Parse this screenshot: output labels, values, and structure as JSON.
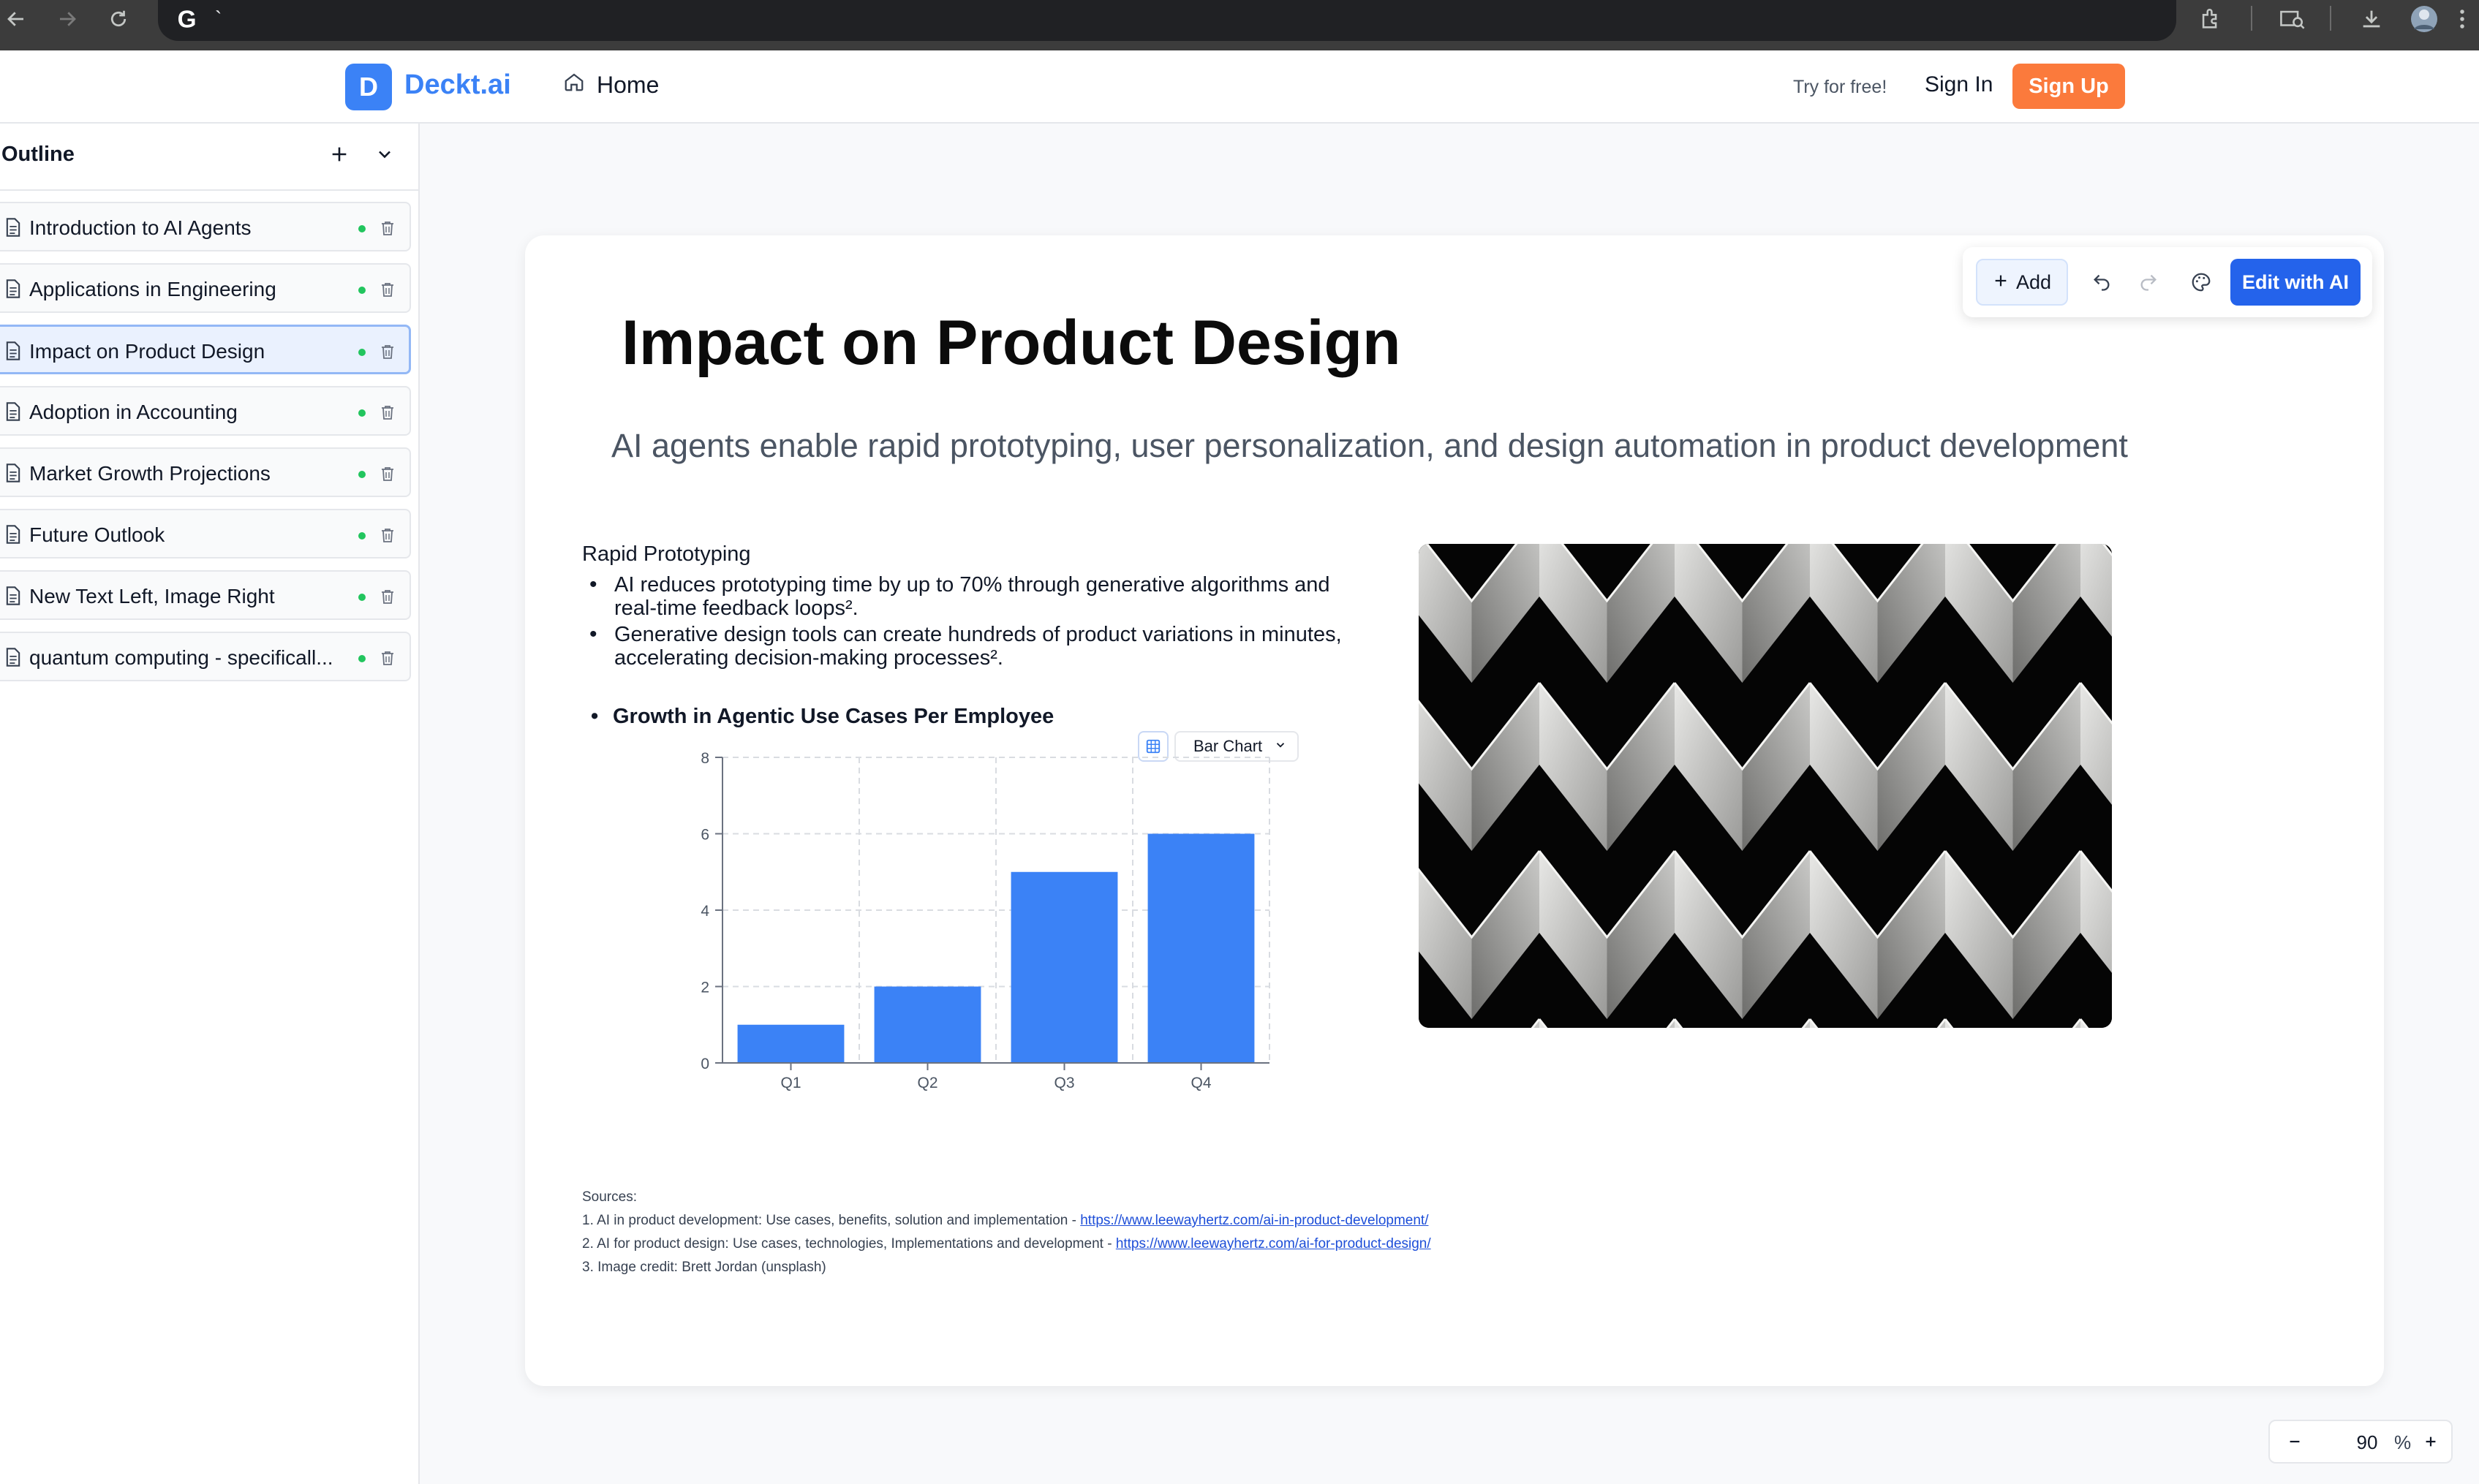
{
  "browser": {
    "address_text": "`"
  },
  "header": {
    "logo_letter": "D",
    "brand": "Deckt.ai",
    "home_label": "Home",
    "try_free": "Try for free!",
    "sign_in": "Sign In",
    "sign_up": "Sign Up"
  },
  "sidebar": {
    "title": "Outline",
    "items": [
      {
        "label": "Introduction to AI Agents"
      },
      {
        "label": "Applications in Engineering"
      },
      {
        "label": "Impact on Product Design",
        "active": true
      },
      {
        "label": "Adoption in Accounting"
      },
      {
        "label": "Market Growth Projections"
      },
      {
        "label": "Future Outlook"
      },
      {
        "label": "New Text Left, Image Right"
      },
      {
        "label": "quantum computing - specificall..."
      }
    ]
  },
  "toolbar": {
    "add_label": "Add",
    "edit_label": "Edit with AI"
  },
  "slide": {
    "title": "Impact on Product Design",
    "subtitle": "AI agents enable rapid prototyping, user personalization, and design automation in product development",
    "section_heading": "Rapid Prototyping",
    "bullets": [
      "AI reduces prototyping time by up to 70% through generative algorithms and real-time feedback loops².",
      "Generative design tools can create hundreds of product variations in minutes, accelerating decision-making processes²."
    ],
    "chart_heading": "Growth in Agentic Use Cases Per Employee",
    "chart_type_label": "Bar Chart",
    "sources_heading": "Sources:",
    "sources": [
      {
        "prefix": "1. AI in product development: Use cases, benefits, solution and implementation - ",
        "link": "https://www.leewayhertz.com/ai-in-product-development/"
      },
      {
        "prefix": "2. AI for product design: Use cases, technologies, Implementations and development - ",
        "link": "https://www.leewayhertz.com/ai-for-product-design/"
      },
      {
        "prefix": "3. Image credit: Brett Jordan (unsplash)",
        "link": ""
      }
    ]
  },
  "chart_data": {
    "type": "bar",
    "categories": [
      "Q1",
      "Q2",
      "Q3",
      "Q4"
    ],
    "values": [
      1,
      2,
      5,
      6
    ],
    "title": "",
    "xlabel": "",
    "ylabel": "",
    "ylim": [
      0,
      8
    ],
    "yticks": [
      0,
      2,
      4,
      6,
      8
    ],
    "grid": true,
    "bar_color": "#3b82f6"
  },
  "zoom": {
    "value": "90",
    "unit": "%"
  },
  "colors": {
    "accent": "#3b82f6",
    "primary_button": "#2463eb",
    "signup_button": "#fb7a3c",
    "status_dot": "#22c55e"
  }
}
